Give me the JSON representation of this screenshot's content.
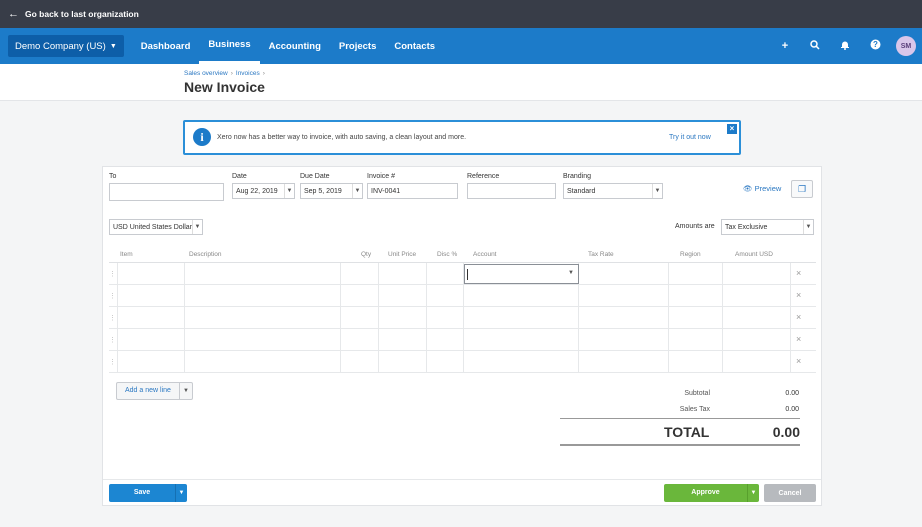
{
  "topbar": {
    "back_label": "Go back to last organization"
  },
  "nav": {
    "org": "Demo Company (US)",
    "items": [
      "Dashboard",
      "Business",
      "Accounting",
      "Projects",
      "Contacts"
    ],
    "active": "Business",
    "avatar_initials": "SM"
  },
  "breadcrumb": {
    "items": [
      "Sales overview",
      "Invoices"
    ]
  },
  "page_title": "New Invoice",
  "banner": {
    "message": "Xero now has a better way to invoice, with auto saving, a clean layout and more.",
    "link": "Try it out now"
  },
  "form": {
    "to_label": "To",
    "to_value": "",
    "date_label": "Date",
    "date_value": "Aug 22, 2019",
    "due_label": "Due Date",
    "due_value": "Sep 5, 2019",
    "invoice_label": "Invoice #",
    "invoice_value": "INV-0041",
    "reference_label": "Reference",
    "reference_value": "",
    "branding_label": "Branding",
    "branding_value": "Standard",
    "preview_label": "Preview",
    "currency_value": "USD United States Dollar",
    "amounts_label": "Amounts are",
    "amounts_value": "Tax Exclusive"
  },
  "columns": [
    "Item",
    "Description",
    "Qty",
    "Unit Price",
    "Disc %",
    "Account",
    "Tax Rate",
    "Region",
    "Amount USD"
  ],
  "add_line_label": "Add a new line",
  "totals": {
    "subtotal_label": "Subtotal",
    "subtotal_value": "0.00",
    "tax_label": "Sales Tax",
    "tax_value": "0.00",
    "total_label": "TOTAL",
    "total_value": "0.00"
  },
  "buttons": {
    "save": "Save",
    "approve": "Approve",
    "cancel": "Cancel"
  },
  "colors": {
    "nav_blue": "#1c7bc9",
    "topbar": "#383d48",
    "save_blue": "#1c86d2",
    "approve_green": "#6ab73b"
  }
}
